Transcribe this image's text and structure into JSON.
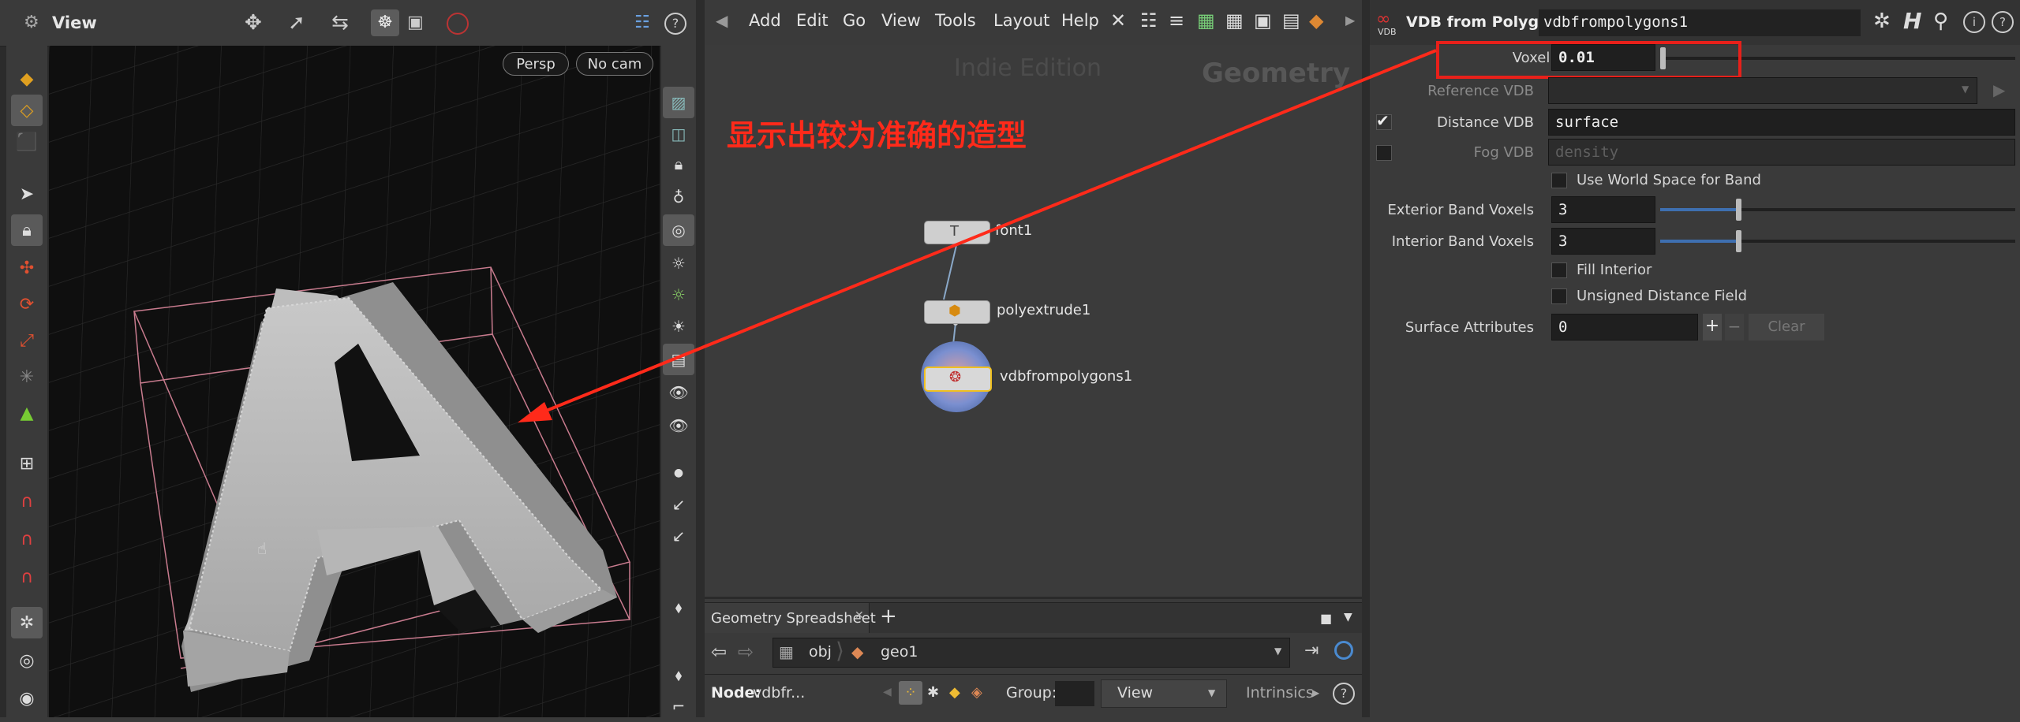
{
  "viewport": {
    "title": "View",
    "persp_label": "Persp",
    "cam_label": "No cam",
    "letter": "A"
  },
  "network": {
    "menu": [
      "Add",
      "Edit",
      "Go",
      "View",
      "Tools",
      "Layout",
      "Help"
    ],
    "watermark": "Indie Edition",
    "context_label": "Geometry",
    "annotation": "显示出较为准确的造型",
    "nodes": [
      {
        "label": "font1"
      },
      {
        "label": "polyextrude1"
      },
      {
        "label": "vdbfrompolygons1"
      }
    ]
  },
  "spreadsheet": {
    "tab_label": "Geometry Spreadsheet",
    "path_obj": "obj",
    "path_geo": "geo1",
    "node_label": "Node:",
    "node_value": "vdbfr...",
    "group_label": "Group:",
    "view_label": "View",
    "intrinsics_label": "Intrinsics"
  },
  "params": {
    "node_type": "VDB from Polygons",
    "node_name": "vdbfrompolygons1",
    "vdb_badge": "VDB",
    "voxel_size_label": "Voxel Size",
    "voxel_size_value": "0.01",
    "reference_vdb_label": "Reference VDB",
    "distance_vdb_label": "Distance VDB",
    "distance_vdb_value": "surface",
    "fog_vdb_label": "Fog VDB",
    "fog_vdb_placeholder": "density",
    "world_space_label": "Use World Space for Band",
    "exterior_band_label": "Exterior Band Voxels",
    "exterior_band_value": "3",
    "interior_band_label": "Interior Band Voxels",
    "interior_band_value": "3",
    "fill_interior_label": "Fill Interior",
    "unsigned_df_label": "Unsigned Distance Field",
    "surface_attr_label": "Surface Attributes",
    "surface_attr_value": "0",
    "clear_label": "Clear",
    "plus_label": "+",
    "minus_label": "−"
  },
  "colors": {
    "annotation_red": "#ff2a1a",
    "highlight_red": "#e8201a",
    "slider_blue": "#3e6fb0",
    "tool_yellow": "#e0a020"
  }
}
